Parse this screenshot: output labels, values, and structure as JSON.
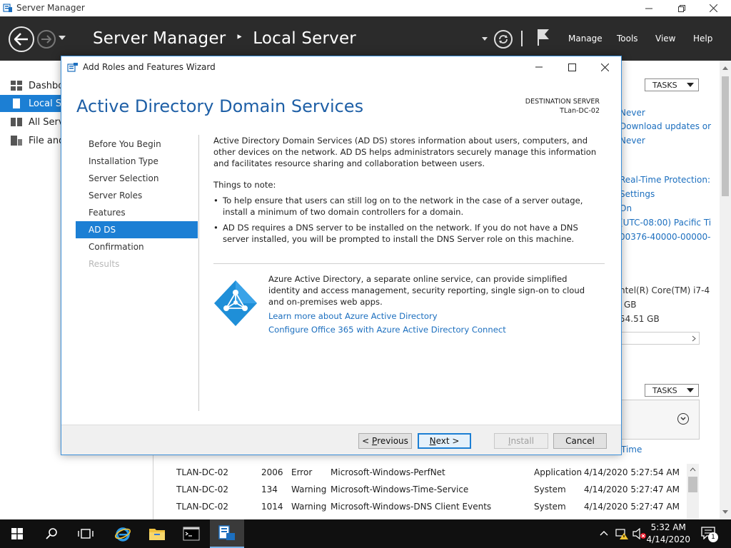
{
  "server_manager": {
    "window_title": "Server Manager",
    "breadcrumb_app": "Server Manager",
    "breadcrumb_separator": "‣",
    "breadcrumb_page": "Local Server",
    "menu": [
      "Manage",
      "Tools",
      "View",
      "Help"
    ],
    "sidebar": [
      {
        "label": "Dashbo",
        "icon": "dashboard-icon"
      },
      {
        "label": "Local Se",
        "icon": "server-icon"
      },
      {
        "label": "All Serv",
        "icon": "servers-icon"
      },
      {
        "label": "File and",
        "icon": "file-storage-icon"
      }
    ],
    "tasks_label": "TASKS",
    "properties": [
      {
        "text": "Never",
        "link": true
      },
      {
        "text": "Download updates or",
        "link": true
      },
      {
        "text": "Never",
        "link": true
      },
      {
        "text": "Real-Time Protection:",
        "link": true
      },
      {
        "text": "Settings",
        "link": true
      },
      {
        "text": "On",
        "link": true
      },
      {
        "text": "(UTC-08:00) Pacific Ti",
        "link": true
      },
      {
        "text": "00376-40000-00000-",
        "link": true
      },
      {
        "text": "ntel(R) Core(TM) i7-4",
        "link": false
      },
      {
        "text": "GB",
        "link": false
      },
      {
        "text": "54.51 GB",
        "link": false
      }
    ],
    "events_partial_header": "Time",
    "events": [
      {
        "server": "TLAN-DC-02",
        "id": "2006",
        "severity": "Error",
        "source": "Microsoft-Windows-PerfNet",
        "log": "Application",
        "datetime": "4/14/2020 5:27:54 AM"
      },
      {
        "server": "TLAN-DC-02",
        "id": "134",
        "severity": "Warning",
        "source": "Microsoft-Windows-Time-Service",
        "log": "System",
        "datetime": "4/14/2020 5:27:47 AM"
      },
      {
        "server": "TLAN-DC-02",
        "id": "1014",
        "severity": "Warning",
        "source": "Microsoft-Windows-DNS Client Events",
        "log": "System",
        "datetime": "4/14/2020 5:27:47 AM"
      }
    ]
  },
  "wizard": {
    "window_title": "Add Roles and Features Wizard",
    "heading": "Active Directory Domain Services",
    "destination_label": "DESTINATION SERVER",
    "destination_server": "TLan-DC-02",
    "steps": [
      {
        "label": "Before You Begin",
        "state": "normal"
      },
      {
        "label": "Installation Type",
        "state": "normal"
      },
      {
        "label": "Server Selection",
        "state": "normal"
      },
      {
        "label": "Server Roles",
        "state": "normal"
      },
      {
        "label": "Features",
        "state": "normal"
      },
      {
        "label": "AD DS",
        "state": "active"
      },
      {
        "label": "Confirmation",
        "state": "normal"
      },
      {
        "label": "Results",
        "state": "disabled"
      }
    ],
    "intro": "Active Directory Domain Services (AD DS) stores information about users, computers, and other devices on the network.  AD DS helps administrators securely manage this information and facilitates resource sharing and collaboration between users.",
    "things_to_note": "Things to note:",
    "bullets": [
      "To help ensure that users can still log on to the network in the case of a server outage, install a minimum of two domain controllers for a domain.",
      "AD DS requires a DNS server to be installed on the network.  If you do not have a DNS server installed, you will be prompted to install the DNS Server role on this machine."
    ],
    "azure_text": "Azure Active Directory, a separate online service, can provide simplified identity and access management, security reporting, single sign-on to cloud and on-premises web apps.",
    "links": [
      "Learn more about Azure Active Directory",
      "Configure Office 365 with Azure Active Directory Connect"
    ],
    "buttons": {
      "previous_pre": "< ",
      "previous_key": "P",
      "previous_rest": "revious",
      "next_key": "N",
      "next_rest": "ext >",
      "install_key": "I",
      "install_rest": "nstall",
      "cancel": "Cancel"
    }
  },
  "taskbar": {
    "time": "5:32 AM",
    "date": "4/14/2020",
    "notification_count": "1"
  },
  "colors": {
    "accent": "#1c7fd4",
    "header_bg": "#2b2b2b",
    "heading_blue": "#1e5fa6",
    "link_blue": "#1c6fbf",
    "azure_blue": "#1f8fd8"
  }
}
